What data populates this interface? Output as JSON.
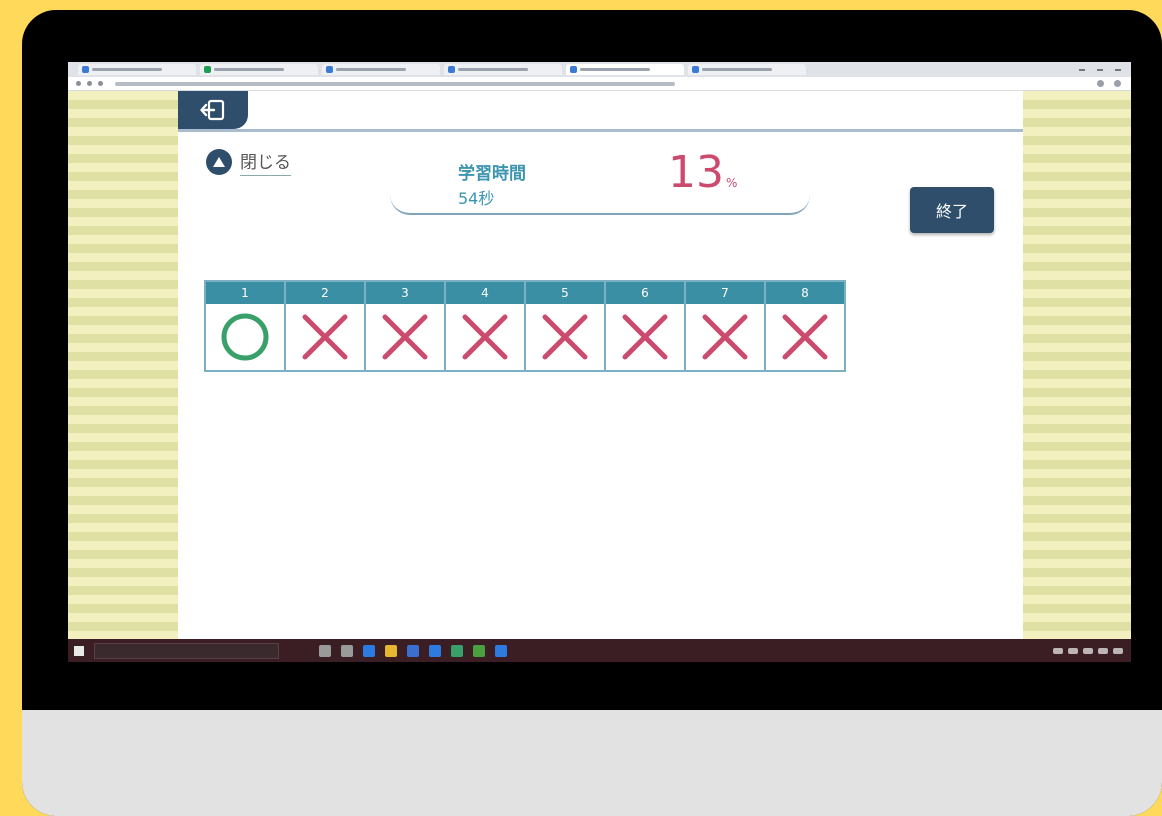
{
  "study": {
    "close_label": "閉じる",
    "time_title": "学習時間",
    "time_value": "54秒",
    "percent_value": "13",
    "percent_unit": "%",
    "finish_label": "終了"
  },
  "answers": [
    {
      "number": "1",
      "result": "correct"
    },
    {
      "number": "2",
      "result": "wrong"
    },
    {
      "number": "3",
      "result": "wrong"
    },
    {
      "number": "4",
      "result": "wrong"
    },
    {
      "number": "5",
      "result": "wrong"
    },
    {
      "number": "6",
      "result": "wrong"
    },
    {
      "number": "7",
      "result": "wrong"
    },
    {
      "number": "8",
      "result": "wrong"
    }
  ],
  "colors": {
    "accent_navy": "#2f4e6c",
    "correct_green": "#3aa06a",
    "wrong_pink": "#cc4a6e",
    "header_teal": "#3a8fa4"
  },
  "icons": {
    "back": "exit-arrow-icon",
    "close": "triangle-up-icon",
    "correct": "circle-mark-icon",
    "wrong": "cross-mark-icon"
  }
}
